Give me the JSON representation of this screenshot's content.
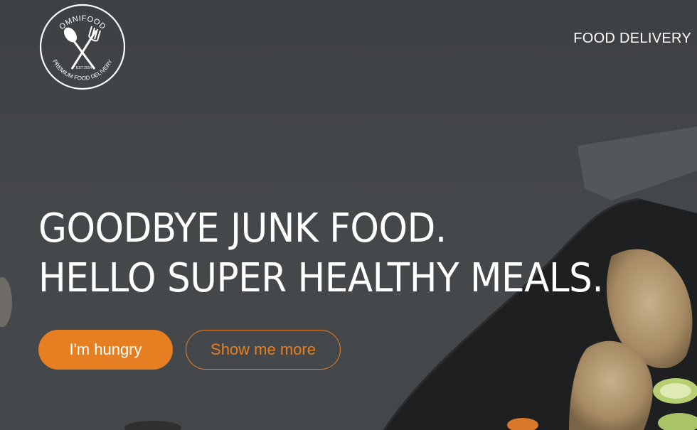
{
  "header": {
    "logo": {
      "name": "OMNIFOOD",
      "tagline": "PREMIUM FOOD DELIVERY",
      "established": "EST 2014",
      "icon": "crossed-spoon-fork-icon"
    },
    "nav_link": "FOOD DELIVERY"
  },
  "hero": {
    "headline_line1": "GOODBYE JUNK FOOD.",
    "headline_line2": "HELLO SUPER HEALTHY MEALS.",
    "primary_button": "I'm hungry",
    "secondary_button": "Show me more"
  },
  "colors": {
    "accent": "#e67e22",
    "overlay": "#3f4245",
    "text": "#ffffff"
  }
}
